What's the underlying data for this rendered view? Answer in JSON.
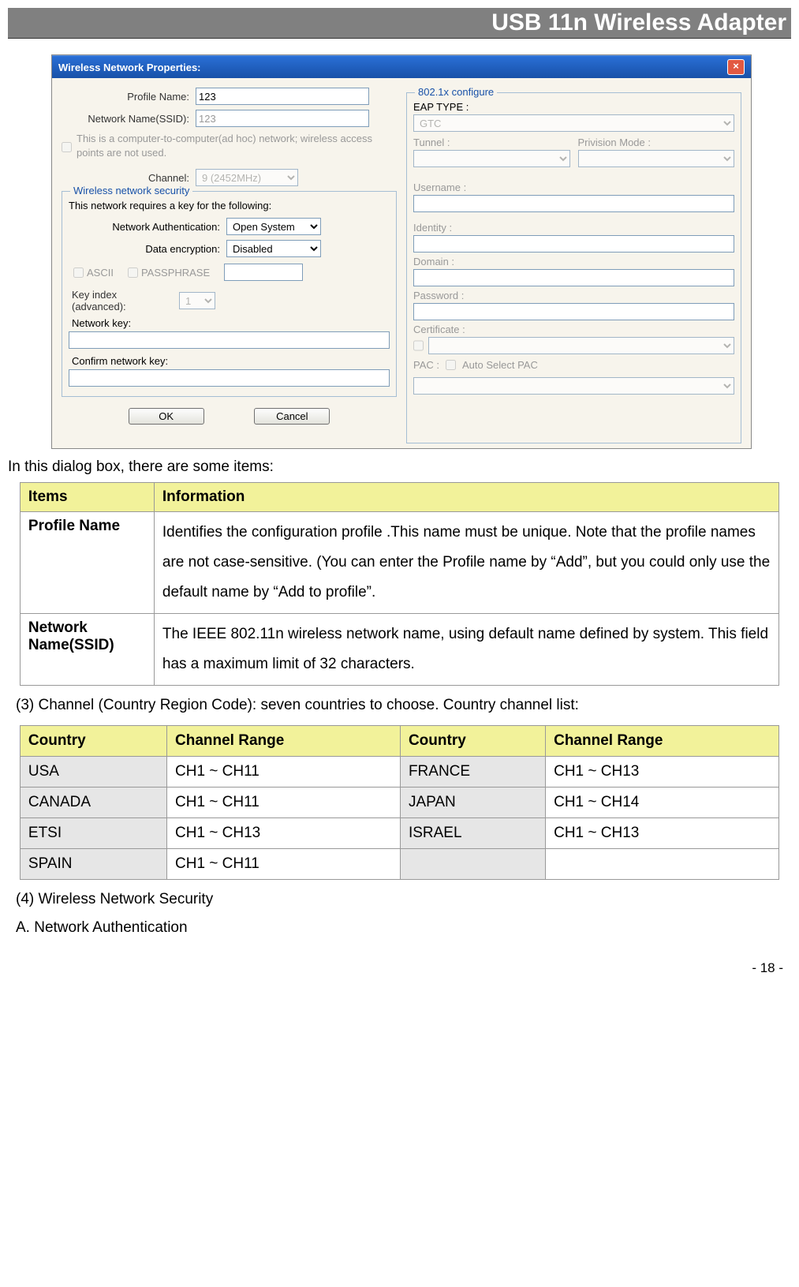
{
  "header": {
    "title": "USB 11n Wireless Adapter"
  },
  "dialog": {
    "title": "Wireless Network Properties:",
    "profile_name_label": "Profile Name:",
    "profile_name_value": "123",
    "ssid_label": "Network Name(SSID):",
    "ssid_value": "123",
    "adhoc_text": "This is a computer-to-computer(ad hoc) network; wireless access points are not used.",
    "channel_label": "Channel:",
    "channel_value": "9 (2452MHz)",
    "security_legend": "Wireless network security",
    "security_desc": "This network requires a key for the following:",
    "net_auth_label": "Network Authentication:",
    "net_auth_value": "Open System",
    "data_enc_label": "Data encryption:",
    "data_enc_value": "Disabled",
    "ascii_label": "ASCII",
    "passphrase_label": "PASSPHRASE",
    "key_index_label": "Key index (advanced):",
    "key_index_value": "1",
    "network_key_label": "Network key:",
    "confirm_key_label": "Confirm network key:",
    "ok_btn": "OK",
    "cancel_btn": "Cancel",
    "config_legend": "802.1x configure",
    "eap_type_label": "EAP TYPE :",
    "eap_type_value": "GTC",
    "tunnel_label": "Tunnel :",
    "provision_label": "Privision Mode :",
    "username_label": "Username :",
    "identity_label": "Identity :",
    "domain_label": "Domain :",
    "password_label": "Password :",
    "certificate_label": "Certificate :",
    "pac_label": "PAC :",
    "auto_pac_label": "Auto Select PAC"
  },
  "intro_text": "In this dialog box, there are some items:",
  "items_table": {
    "h1": "Items",
    "h2": "Information",
    "rows": [
      {
        "item": "Profile Name",
        "info": "Identifies the configuration profile .This name must be unique. Note that the profile names are not case-sensitive.\n(You can enter the Profile name by “Add”, but you could only use the default name by “Add to profile”."
      },
      {
        "item": "Network Name(SSID)",
        "info": "The IEEE 802.11n wireless network name, using default name defined by system. This field has a maximum limit of 32 characters."
      }
    ]
  },
  "channel_intro": "(3) Channel (Country Region Code): seven countries to choose. Country channel list:",
  "country_table": {
    "h_country": "Country",
    "h_range": "Channel Range",
    "rows": [
      {
        "c1": "USA",
        "r1": "CH1 ~ CH11",
        "c2": "FRANCE",
        "r2": "CH1 ~ CH13"
      },
      {
        "c1": "CANADA",
        "r1": "CH1 ~ CH11",
        "c2": "JAPAN",
        "r2": "CH1 ~ CH14"
      },
      {
        "c1": "ETSI",
        "r1": "CH1 ~ CH13",
        "c2": "ISRAEL",
        "r2": "CH1 ~ CH13"
      },
      {
        "c1": "SPAIN",
        "r1": "CH1 ~ CH11",
        "c2": "",
        "r2": ""
      }
    ]
  },
  "sec4": "(4) Wireless Network Security",
  "secA": "A. Network Authentication",
  "footer": "- 18 -"
}
